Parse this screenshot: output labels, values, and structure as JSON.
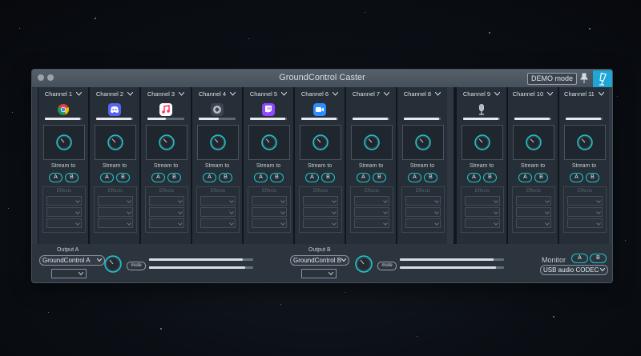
{
  "window": {
    "title": "GroundControl Caster",
    "demo_button": "DEMO mode"
  },
  "channel_common": {
    "stream_to": "Stream to",
    "pill_a": "A",
    "pill_b": "B",
    "effects": "Effects"
  },
  "channels": [
    {
      "label": "Channel 1",
      "icon": "chrome-icon",
      "meter": 0.95
    },
    {
      "label": "Channel 2",
      "icon": "discord-icon",
      "meter": 0.95
    },
    {
      "label": "Channel 3",
      "icon": "music-icon",
      "meter": 0.5
    },
    {
      "label": "Channel 4",
      "icon": "app-icon",
      "meter": 0.55
    },
    {
      "label": "Channel 5",
      "icon": "twitch-icon",
      "meter": 0.95
    },
    {
      "label": "Channel 6",
      "icon": "zoom-icon",
      "meter": 0.95
    },
    {
      "label": "Channel 7",
      "icon": "",
      "meter": 0.95
    },
    {
      "label": "Channel 8",
      "icon": "",
      "meter": 0.95
    },
    {
      "label": "Channel 9",
      "icon": "microphone-icon",
      "meter": 0.95
    },
    {
      "label": "Channel 10",
      "icon": "",
      "meter": 0.95
    },
    {
      "label": "Channel 11",
      "icon": "",
      "meter": 0.95
    }
  ],
  "outputs": {
    "a": {
      "label": "Output A",
      "device": "GroundControl A",
      "mute": "mute",
      "meter_top": 0.9,
      "meter_bottom": 0.92
    },
    "b": {
      "label": "Output B",
      "device": "GroundControl B",
      "mute": "mute",
      "meter_top": 0.9,
      "meter_bottom": 0.92
    }
  },
  "monitor": {
    "label": "Monitor",
    "pill_a": "A",
    "pill_b": "B",
    "device": "USB audio CODEC"
  },
  "colors": {
    "accent": "#1cc7cf",
    "brand": "#1ea6d6"
  }
}
